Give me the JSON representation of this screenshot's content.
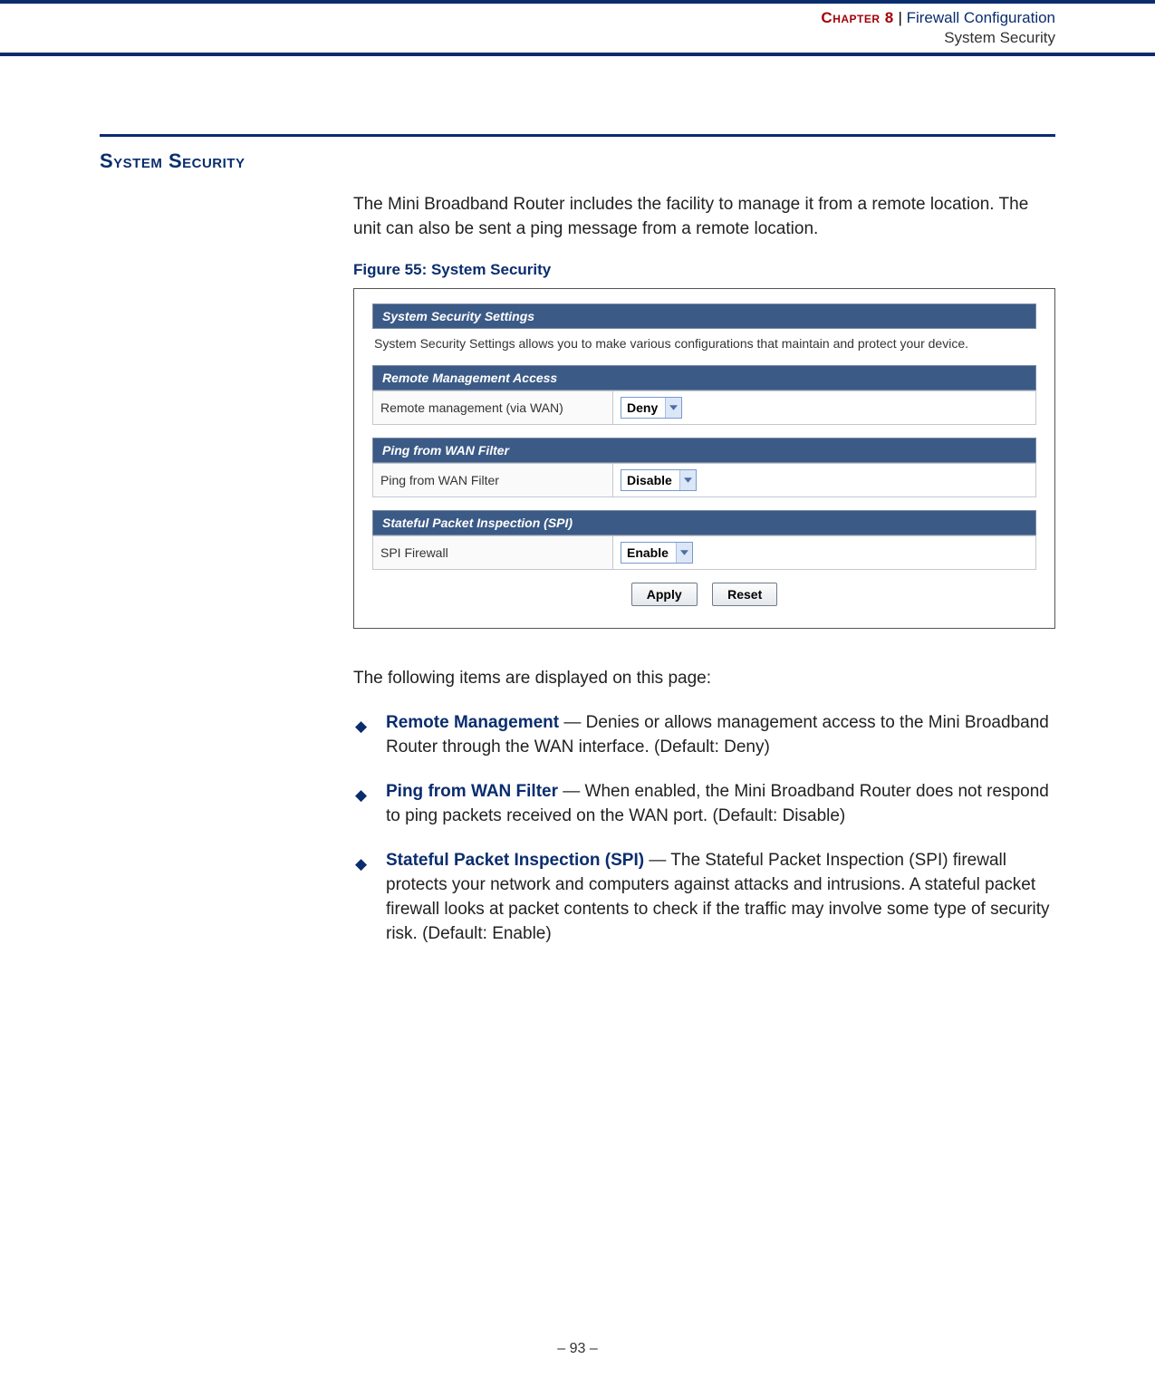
{
  "header": {
    "chapter_label": "Chapter 8",
    "divider": "  |  ",
    "chapter_title": "Firewall Configuration",
    "subtitle": "System Security"
  },
  "section": {
    "heading": "System Security",
    "intro": "The Mini Broadband Router includes the facility to manage it from a remote location. The unit can also be sent a ping message from a remote location."
  },
  "figure": {
    "caption": "Figure 55:  System Security",
    "panel1": {
      "title": "System Security Settings",
      "desc": "System Security Settings allows you to make various configurations that maintain and protect your device."
    },
    "panel2": {
      "title": "Remote Management Access",
      "label": "Remote management (via WAN)",
      "value": "Deny"
    },
    "panel3": {
      "title": "Ping from WAN Filter",
      "label": "Ping from WAN Filter",
      "value": "Disable"
    },
    "panel4": {
      "title": "Stateful Packet Inspection (SPI)",
      "label": "SPI Firewall",
      "value": "Enable"
    },
    "buttons": {
      "apply": "Apply",
      "reset": "Reset"
    }
  },
  "items_intro": "The following items are displayed on this page:",
  "items": [
    {
      "title": "Remote Management",
      "text": " — Denies or allows management access to the Mini Broadband Router through the WAN interface. (Default: Deny)"
    },
    {
      "title": "Ping from WAN Filter",
      "text": " — When enabled, the Mini Broadband Router does not respond to ping packets received on the WAN port. (Default: Disable)"
    },
    {
      "title": "Stateful Packet Inspection (SPI)",
      "text": " — The Stateful Packet Inspection (SPI) firewall protects your network and computers against attacks and intrusions. A stateful packet firewall looks at packet contents to check if the traffic may involve some type of security risk. (Default: Enable)"
    }
  ],
  "footer": {
    "page": "–  93  –"
  }
}
